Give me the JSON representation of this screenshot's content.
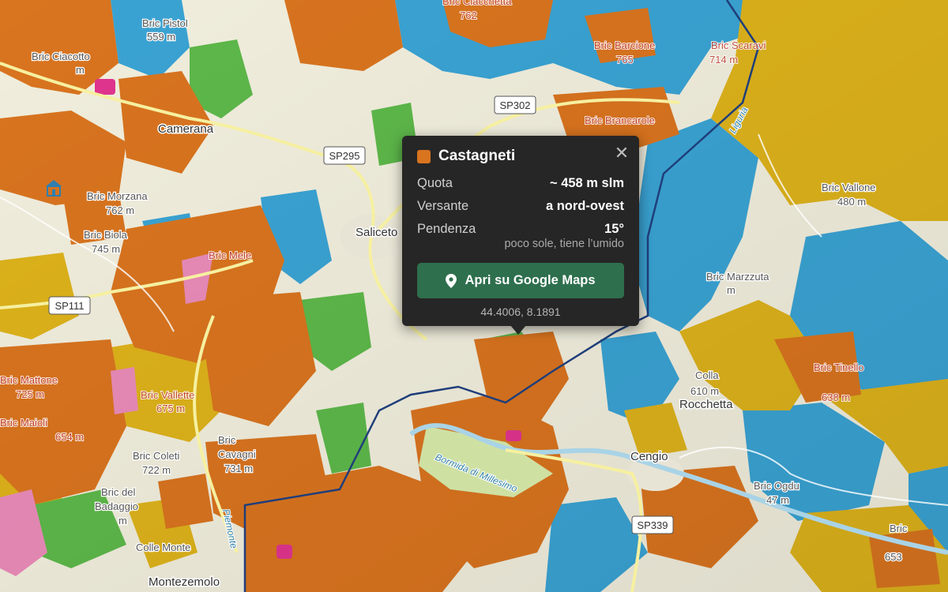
{
  "map": {
    "colors": {
      "base": "#f1eedd",
      "chestnut": "#d9741f",
      "yellow": "#ddb21b",
      "blue": "#3aa3d3",
      "green": "#5db84a",
      "pink": "#e98bb8",
      "magenta": "#e0358e",
      "border": "#1f3e7a"
    },
    "places": [
      {
        "name": "Camerana"
      },
      {
        "name": "Saliceto"
      },
      {
        "name": "Rocchetta"
      },
      {
        "name": "Cengio"
      },
      {
        "name": "Montezemolo"
      }
    ],
    "peaks": [
      {
        "name": "Bric Pistol",
        "elev": "559 m"
      },
      {
        "name": "Bric Ciacotto",
        "elev": "m"
      },
      {
        "name": "Bric Morzana",
        "elev": "762 m"
      },
      {
        "name": "Bric Biola",
        "elev": "745 m"
      },
      {
        "name": "Bric Coleti",
        "elev": "722 m"
      },
      {
        "name": "Bric",
        "elev": "731 m"
      },
      {
        "name": "Cavagni",
        "elev": ""
      },
      {
        "name": "Bric del",
        "elev": "m"
      },
      {
        "name": "Badaggio",
        "elev": ""
      },
      {
        "name": "Colle Monte",
        "elev": ""
      },
      {
        "name": "Bric Ogdu",
        "elev": "47 m"
      },
      {
        "name": "Bric",
        "elev": "653"
      },
      {
        "name": "Colla",
        "elev": "610 m"
      },
      {
        "name": "Bric Vallone",
        "elev": "480 m"
      },
      {
        "name": "Bric Marzzuta",
        "elev": "m"
      },
      {
        "name": "Bric Brancarole",
        "elev": ""
      },
      {
        "name": "Bric Barcione",
        "elev": "765"
      },
      {
        "name": "Bric Scaravi",
        "elev": "714 m"
      },
      {
        "name": "Bric Tinello",
        "elev": "638 m"
      },
      {
        "name": "Bric Vallette",
        "elev": "675 m"
      },
      {
        "name": "Bric Mattone",
        "elev": "725 m"
      },
      {
        "name": "Bric Maioli",
        "elev": "654 m"
      },
      {
        "name": "Bric Ciacchetta",
        "elev": "762"
      },
      {
        "name": "Bric Mele",
        "elev": ""
      }
    ],
    "roads": [
      {
        "label": "SP302"
      },
      {
        "label": "SP295"
      },
      {
        "label": "SP111"
      },
      {
        "label": "SP339"
      }
    ],
    "rivers": [
      {
        "label": "Bormida di Millesimo"
      },
      {
        "label": "Piemonte"
      },
      {
        "label": "Liguria"
      }
    ]
  },
  "popup": {
    "title": "Castagneti",
    "swatch_color": "#d9741f",
    "close_symbol": "✕",
    "rows": [
      {
        "key": "Quota",
        "value": "~ 458 m slm"
      },
      {
        "key": "Versante",
        "value": "a nord-ovest"
      },
      {
        "key": "Pendenza",
        "value": "15°"
      }
    ],
    "note": "poco sole, tiene l’umido",
    "button_label": "Apri su Google Maps",
    "button_color": "#2e6f4d",
    "coords": "44.4006, 8.1891"
  }
}
